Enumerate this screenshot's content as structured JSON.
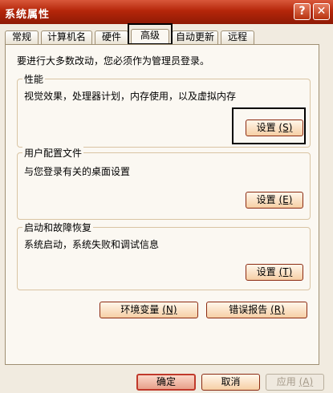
{
  "window": {
    "title": "系统属性",
    "help_glyph": "?",
    "close_glyph": "✕"
  },
  "tabs": [
    {
      "label": "常规"
    },
    {
      "label": "计算机名"
    },
    {
      "label": "硬件"
    },
    {
      "label": "高级"
    },
    {
      "label": "自动更新"
    },
    {
      "label": "远程"
    }
  ],
  "active_tab": "高级",
  "notice": "要进行大多数改动，您必须作为管理员登录。",
  "groups": {
    "performance": {
      "label": "性能",
      "description": "视觉效果，处理器计划，内存使用，以及虚拟内存",
      "button_text": "设置",
      "button_key": "(S)"
    },
    "profile": {
      "label": "用户配置文件",
      "description": "与您登录有关的桌面设置",
      "button_text": "设置",
      "button_key": "(E)"
    },
    "startup": {
      "label": "启动和故障恢复",
      "description": "系统启动，系统失败和调试信息",
      "button_text": "设置",
      "button_key": "(T)"
    }
  },
  "env_button": {
    "text": "环境变量",
    "key": "(N)"
  },
  "error_button": {
    "text": "错误报告",
    "key": "(R)"
  },
  "footer": {
    "ok": "确定",
    "cancel": "取消",
    "apply": "应用",
    "apply_key": "(A)"
  },
  "colors": {
    "title_bar": "#b5260a",
    "panel_bg": "#fbf8f2",
    "group_border": "#d9c4a3",
    "button_border": "#8b2a11"
  }
}
